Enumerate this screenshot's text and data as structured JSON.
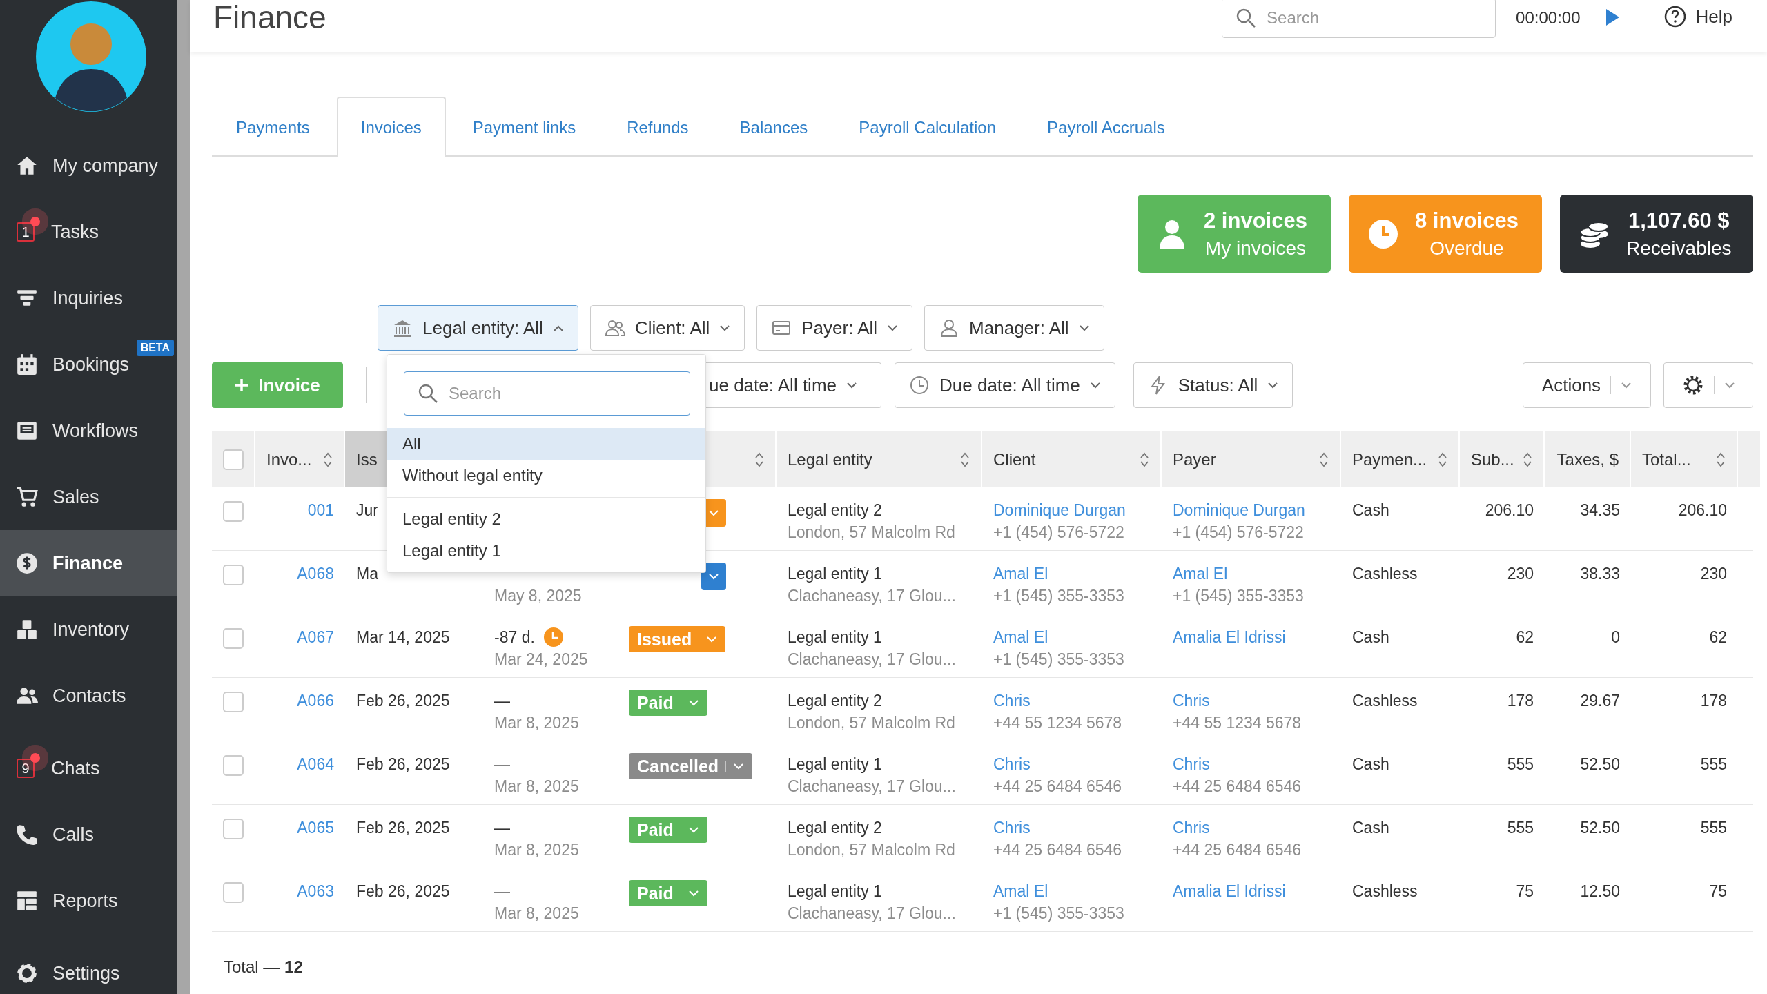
{
  "sidebar": {
    "groups": [
      [
        {
          "label": "My company",
          "selected": false
        },
        {
          "label": "Tasks",
          "selected": false,
          "count": "1"
        },
        {
          "label": "Inquiries",
          "selected": false
        },
        {
          "label": "Bookings",
          "selected": false,
          "badge": "BETA"
        },
        {
          "label": "Workflows",
          "selected": false
        },
        {
          "label": "Sales",
          "selected": false
        },
        {
          "label": "Finance",
          "selected": true
        },
        {
          "label": "Inventory",
          "selected": false
        },
        {
          "label": "Contacts",
          "selected": false
        }
      ],
      [
        {
          "label": "Chats",
          "selected": false,
          "count": "9"
        },
        {
          "label": "Calls",
          "selected": false
        },
        {
          "label": "Reports",
          "selected": false
        }
      ],
      [
        {
          "label": "Settings",
          "selected": false
        }
      ]
    ]
  },
  "header": {
    "title": "Finance",
    "search": {
      "placeholder": "Search"
    },
    "timer": "00:00:00",
    "help": "Help"
  },
  "tabs": [
    {
      "label": "Payments",
      "selected": false
    },
    {
      "label": "Invoices",
      "selected": true
    },
    {
      "label": "Payment links",
      "selected": false
    },
    {
      "label": "Refunds",
      "selected": false
    },
    {
      "label": "Balances",
      "selected": false
    },
    {
      "label": "Payroll Calculation",
      "selected": false
    },
    {
      "label": "Payroll Accruals",
      "selected": false
    }
  ],
  "stats": [
    {
      "value": "2 invoices",
      "label": "My invoices",
      "color": "#5cb85c"
    },
    {
      "value": "8 invoices",
      "label": "Overdue",
      "color": "#f7941d"
    },
    {
      "value": "1,107.60 $",
      "label": "Receivables",
      "color": "#2b2f33"
    }
  ],
  "filters": [
    {
      "label": "Legal entity: All",
      "expanded": true
    },
    {
      "label": "Client: All",
      "expanded": false
    },
    {
      "label": "Payer: All",
      "expanded": false
    },
    {
      "label": "Manager: All",
      "expanded": false
    }
  ],
  "toolbar": {
    "add_button": "Invoice",
    "filters": [
      {
        "label": "ue date: All time"
      },
      {
        "label": "Due date: All time"
      },
      {
        "label": "Status: All"
      }
    ],
    "actions": "Actions"
  },
  "dropdown": {
    "search": {
      "placeholder": "Search"
    },
    "groups": [
      [
        {
          "label": "All",
          "selected": true
        },
        {
          "label": "Without legal entity",
          "selected": false
        }
      ],
      [
        {
          "label": "Legal entity 2",
          "selected": false
        },
        {
          "label": "Legal entity 1",
          "selected": false
        }
      ]
    ]
  },
  "table": {
    "select_all": {
      "checked": false
    },
    "columns": [
      {
        "label": "Invo...",
        "sortable": true,
        "sorted": false
      },
      {
        "label": "Iss",
        "sorted": true
      },
      {},
      {
        "sortable": true
      },
      {
        "label": "Legal entity",
        "sortable": true,
        "sorted": false
      },
      {
        "label": "Client",
        "sortable": true,
        "sorted": false
      },
      {
        "label": "Payer",
        "sortable": true,
        "sorted": false
      },
      {
        "label": "Paymen...",
        "sortable": true,
        "sorted": false
      },
      {
        "label": "Sub...",
        "sortable": true,
        "sorted": false
      },
      {
        "label": "Taxes, $",
        "sortable": false,
        "sorted": false
      },
      {
        "label": "Total...",
        "sortable": true,
        "sorted": false
      }
    ],
    "rows": [
      {
        "checked": false,
        "number": "001",
        "issued": "Jur",
        "status": {
          "color": "#f7941d"
        },
        "entity": {
          "name": "Legal entity 2",
          "address": "London, 57 Malcolm Rd"
        },
        "client": {
          "name": "Dominique Durgan",
          "phone": "+1 (454) 576-5722"
        },
        "payer": {
          "name": "Dominique Durgan",
          "phone": "+1 (454) 576-5722"
        },
        "payment": "Cash",
        "subtotal": "206.10",
        "taxes": "34.35",
        "total": "206.10"
      },
      {
        "checked": false,
        "number": "A068",
        "issued": "Ma",
        "due": {
          "date": "May 8, 2025"
        },
        "status": {
          "color": "#2f80d0"
        },
        "entity": {
          "name": "Legal entity 1",
          "address": "Clachaneasy, 17 Glou..."
        },
        "client": {
          "name": "Amal El",
          "phone": "+1 (545) 355-3353"
        },
        "payer": {
          "name": "Amal El",
          "phone": "+1 (545) 355-3353"
        },
        "payment": "Cashless",
        "subtotal": "230",
        "taxes": "38.33",
        "total": "230"
      },
      {
        "checked": false,
        "number": "A067",
        "issued": "Mar 14, 2025",
        "due": {
          "overdue": true,
          "days": "-87 d.",
          "date": "Mar 24, 2025"
        },
        "status": {
          "label": "Issued",
          "color": "#f7941d"
        },
        "entity": {
          "name": "Legal entity 1",
          "address": "Clachaneasy, 17 Glou..."
        },
        "client": {
          "name": "Amal El",
          "phone": "+1 (545) 355-3353"
        },
        "payer": {
          "name": "Amalia El Idrissi"
        },
        "payment": "Cash",
        "subtotal": "62",
        "taxes": "0",
        "total": "62"
      },
      {
        "checked": false,
        "number": "A066",
        "issued": "Feb 26, 2025",
        "due": {
          "overdue": false,
          "days": "—",
          "date": "Mar 8, 2025"
        },
        "status": {
          "label": "Paid",
          "color": "#5cb85c"
        },
        "entity": {
          "name": "Legal entity 2",
          "address": "London, 57 Malcolm Rd"
        },
        "client": {
          "name": "Chris",
          "phone": "+44 55 1234 5678"
        },
        "payer": {
          "name": "Chris",
          "phone": "+44 55 1234 5678"
        },
        "payment": "Cashless",
        "subtotal": "178",
        "taxes": "29.67",
        "total": "178"
      },
      {
        "checked": false,
        "number": "A064",
        "issued": "Feb 26, 2025",
        "due": {
          "overdue": false,
          "days": "—",
          "date": "Mar 8, 2025"
        },
        "status": {
          "label": "Cancelled",
          "color": "#8a8a8a"
        },
        "entity": {
          "name": "Legal entity 1",
          "address": "Clachaneasy, 17 Glou..."
        },
        "client": {
          "name": "Chris",
          "phone": "+44 25 6484 6546"
        },
        "payer": {
          "name": "Chris",
          "phone": "+44 25 6484 6546"
        },
        "payment": "Cash",
        "subtotal": "555",
        "taxes": "52.50",
        "total": "555"
      },
      {
        "checked": false,
        "number": "A065",
        "issued": "Feb 26, 2025",
        "due": {
          "overdue": false,
          "days": "—",
          "date": "Mar 8, 2025"
        },
        "status": {
          "label": "Paid",
          "color": "#5cb85c"
        },
        "entity": {
          "name": "Legal entity 2",
          "address": "London, 57 Malcolm Rd"
        },
        "client": {
          "name": "Chris",
          "phone": "+44 25 6484 6546"
        },
        "payer": {
          "name": "Chris",
          "phone": "+44 25 6484 6546"
        },
        "payment": "Cash",
        "subtotal": "555",
        "taxes": "52.50",
        "total": "555"
      },
      {
        "checked": false,
        "number": "A063",
        "issued": "Feb 26, 2025",
        "due": {
          "overdue": false,
          "days": "—",
          "date": "Mar 8, 2025"
        },
        "status": {
          "label": "Paid",
          "color": "#5cb85c"
        },
        "entity": {
          "name": "Legal entity 1",
          "address": "Clachaneasy, 17 Glou..."
        },
        "client": {
          "name": "Amal El",
          "phone": "+1 (545) 355-3353"
        },
        "payer": {
          "name": "Amalia El Idrissi"
        },
        "payment": "Cashless",
        "subtotal": "75",
        "taxes": "12.50",
        "total": "75"
      }
    ],
    "total": "Total — **12**"
  }
}
